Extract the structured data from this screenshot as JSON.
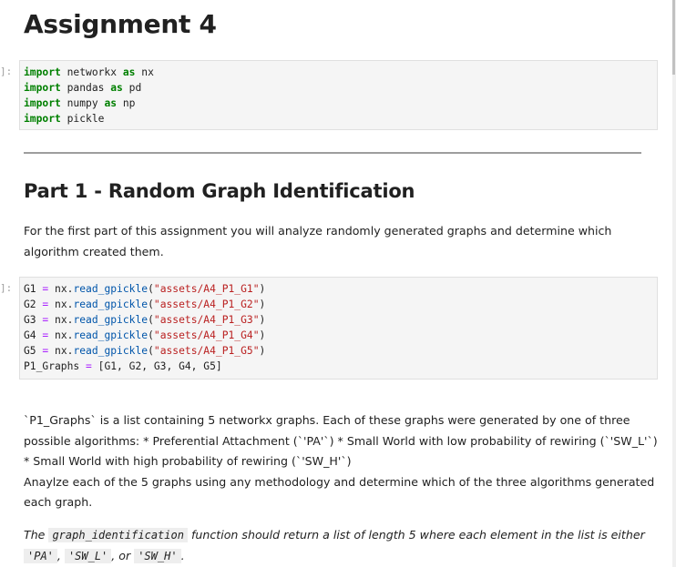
{
  "notebook": {
    "title": "Assignment 4",
    "cells": {
      "imports": {
        "prompt": "]:",
        "lines": [
          {
            "kw": "import",
            "mod": "networkx",
            "as": "as",
            "alias": "nx"
          },
          {
            "kw": "import",
            "mod": "pandas",
            "as": "as",
            "alias": "pd"
          },
          {
            "kw": "import",
            "mod": "numpy",
            "as": "as",
            "alias": "np"
          },
          {
            "kw": "import",
            "mod": "pickle"
          }
        ]
      },
      "load_graphs": {
        "prompt": "]:",
        "lines": [
          {
            "var": "G1",
            "eq": "=",
            "obj": "nx.",
            "fn": "read_gpickle",
            "open": "(",
            "arg": "\"assets/A4_P1_G1\"",
            "close": ")"
          },
          {
            "var": "G2",
            "eq": "=",
            "obj": "nx.",
            "fn": "read_gpickle",
            "open": "(",
            "arg": "\"assets/A4_P1_G2\"",
            "close": ")"
          },
          {
            "var": "G3",
            "eq": "=",
            "obj": "nx.",
            "fn": "read_gpickle",
            "open": "(",
            "arg": "\"assets/A4_P1_G3\"",
            "close": ")"
          },
          {
            "var": "G4",
            "eq": "=",
            "obj": "nx.",
            "fn": "read_gpickle",
            "open": "(",
            "arg": "\"assets/A4_P1_G4\"",
            "close": ")"
          },
          {
            "var": "G5",
            "eq": "=",
            "obj": "nx.",
            "fn": "read_gpickle",
            "open": "(",
            "arg": "\"assets/A4_P1_G5\"",
            "close": ")"
          }
        ],
        "last_line": {
          "var": "P1_Graphs",
          "eq": "=",
          "rest": "[G1, G2, G3, G4, G5]"
        }
      }
    },
    "part1": {
      "heading": "Part 1 - Random Graph Identification",
      "intro_lines": [
        "For the first part of this assignment you will analyze randomly generated graphs and determine which",
        "algorithm created them."
      ],
      "description_lines": [
        "`P1_Graphs` is a list containing 5 networkx graphs. Each of these graphs were generated by one of three",
        "possible algorithms: * Preferential Attachment (`'PA'`) * Small World with low probability of rewiring (`'SW_L'`)",
        "* Small World with high probability of rewiring (`'SW_H'`)",
        "Anaylze each of the 5 graphs using any methodology and determine which of the three algorithms generated",
        "each graph."
      ],
      "return_note": {
        "prefix": "The",
        "func_name": "graph_identification",
        "middle": "function should return a list of length 5 where each element in the list is either",
        "opt1": "'PA'",
        "sep1": ",",
        "opt2": "'SW_L'",
        "sep2": ", or",
        "opt3": "'SW_H'",
        "end": "."
      }
    }
  },
  "colors": {
    "keyword": "#008000",
    "operator": "#aa22ff",
    "function": "#0055aa",
    "string": "#ba2121",
    "cell_bg": "#f5f5f5"
  }
}
